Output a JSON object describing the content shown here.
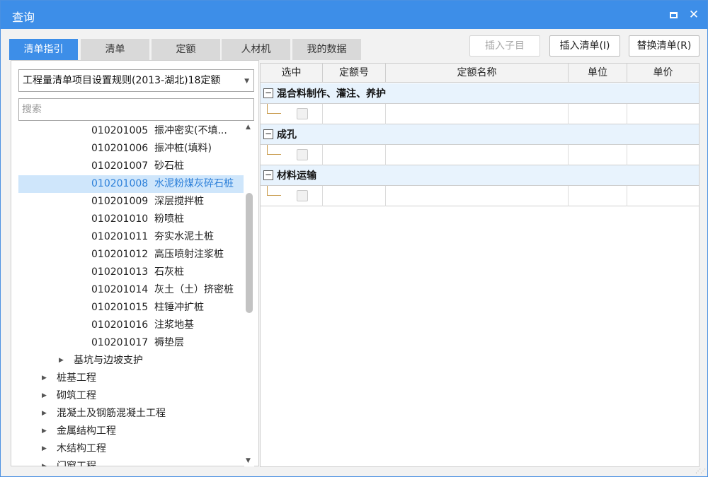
{
  "window": {
    "title": "查询"
  },
  "tabs": [
    {
      "label": "清单指引",
      "active": true
    },
    {
      "label": "清单",
      "active": false
    },
    {
      "label": "定额",
      "active": false
    },
    {
      "label": "人材机",
      "active": false
    },
    {
      "label": "我的数据",
      "active": false
    }
  ],
  "toolbar": {
    "insert_child": "插入子目",
    "insert_bill": "插入清单(I)",
    "replace_bill": "替换清单(R)"
  },
  "left": {
    "combo_value": "工程量清单项目设置规则(2013-湖北)18定额",
    "search_placeholder": "搜索",
    "items": [
      {
        "code": "010201005",
        "name": "振冲密实(不填..."
      },
      {
        "code": "010201006",
        "name": "振冲桩(填料)"
      },
      {
        "code": "010201007",
        "name": "砂石桩"
      },
      {
        "code": "010201008",
        "name": "水泥粉煤灰碎石桩",
        "selected": true
      },
      {
        "code": "010201009",
        "name": "深层搅拌桩"
      },
      {
        "code": "010201010",
        "name": "粉喷桩"
      },
      {
        "code": "010201011",
        "name": "夯实水泥土桩"
      },
      {
        "code": "010201012",
        "name": "高压喷射注浆桩"
      },
      {
        "code": "010201013",
        "name": "石灰桩"
      },
      {
        "code": "010201014",
        "name": "灰土（土）挤密桩"
      },
      {
        "code": "010201015",
        "name": "柱锤冲扩桩"
      },
      {
        "code": "010201016",
        "name": "注浆地基"
      },
      {
        "code": "010201017",
        "name": "褥垫层"
      }
    ],
    "sub_folder": "基坑与边坡支护",
    "folders": [
      "桩基工程",
      "砌筑工程",
      "混凝土及钢筋混凝土工程",
      "金属结构工程",
      "木结构工程",
      "门窗工程"
    ]
  },
  "grid": {
    "columns": [
      "选中",
      "定额号",
      "定额名称",
      "单位",
      "单价"
    ],
    "groups": [
      {
        "label": "混合料制作、灌注、养护"
      },
      {
        "label": "成孔"
      },
      {
        "label": "材料运输"
      }
    ]
  },
  "colors": {
    "accent": "#3d8ee8",
    "selected_bg": "#cfe6fb",
    "group_bg": "#e8f3fd"
  }
}
